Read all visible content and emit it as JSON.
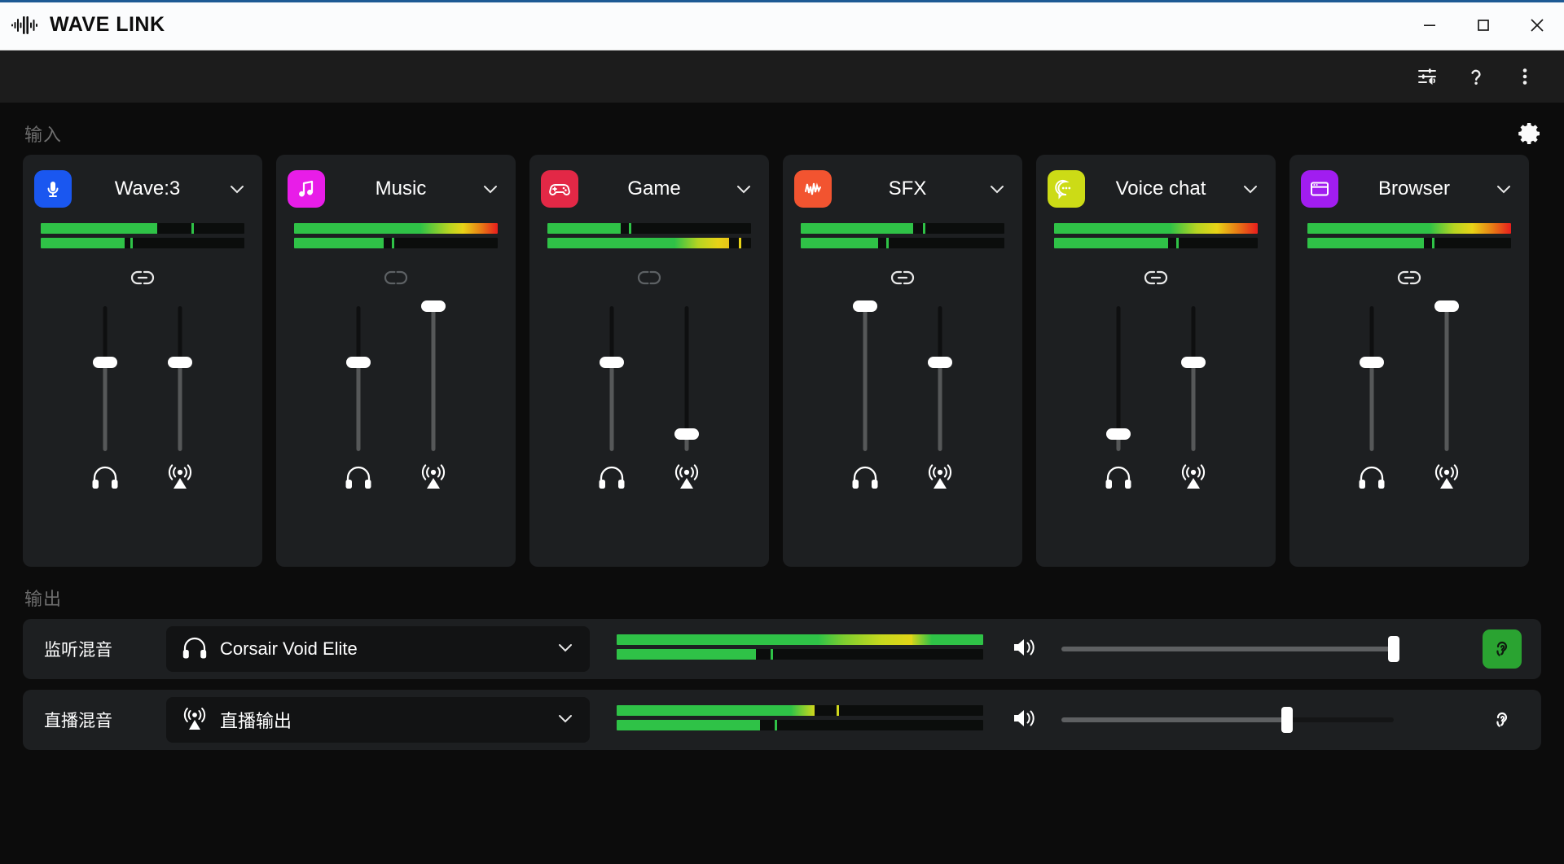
{
  "window": {
    "title": "WAVE LINK",
    "logo_icon": "waveform-icon",
    "minimize_label": "–",
    "maximize_label": "□",
    "close_label": "✕"
  },
  "toolbar": {
    "items": [
      {
        "name": "mixer-settings-icon",
        "label": "Mixer settings"
      },
      {
        "name": "help-icon",
        "label": "?"
      },
      {
        "name": "more-menu-icon",
        "label": "More options"
      }
    ]
  },
  "input_section": {
    "title": "输入",
    "settings_icon": "gear-icon",
    "channels": [
      {
        "id": "wave3",
        "name": "Wave:3",
        "icon": "microphone-icon",
        "icon_color": "#1a57f0",
        "linked": true,
        "link_icon": "link-connected-icon",
        "meters": [
          {
            "level": 57,
            "peak": 74,
            "gradient": false
          },
          {
            "level": 41,
            "peak": 44,
            "gradient": false
          }
        ],
        "faders": [
          {
            "name": "monitor-fader",
            "icon": "headphones-icon",
            "value": 61
          },
          {
            "name": "stream-fader",
            "icon": "broadcast-icon",
            "value": 61
          }
        ]
      },
      {
        "id": "music",
        "name": "Music",
        "icon": "music-note-icon",
        "icon_color": "#e81de8",
        "linked": false,
        "link_icon": "link-broken-icon",
        "meters": [
          {
            "level": 100,
            "peak": 0,
            "gradient": true
          },
          {
            "level": 44,
            "peak": 48,
            "gradient": false
          }
        ],
        "faders": [
          {
            "name": "monitor-fader",
            "icon": "headphones-icon",
            "value": 61
          },
          {
            "name": "stream-fader",
            "icon": "broadcast-icon",
            "value": 100
          }
        ]
      },
      {
        "id": "game",
        "name": "Game",
        "icon": "gamepad-icon",
        "icon_color": "#e32846",
        "linked": false,
        "link_icon": "link-broken-icon",
        "meters": [
          {
            "level": 36,
            "peak": 40,
            "gradient": false
          },
          {
            "level": 89,
            "peak": 94,
            "gradient": true
          }
        ],
        "faders": [
          {
            "name": "monitor-fader",
            "icon": "headphones-icon",
            "value": 61
          },
          {
            "name": "stream-fader",
            "icon": "broadcast-icon",
            "value": 12
          }
        ]
      },
      {
        "id": "sfx",
        "name": "SFX",
        "icon": "sfx-waveform-icon",
        "icon_color": "#f25430",
        "linked": true,
        "link_icon": "link-connected-icon",
        "meters": [
          {
            "level": 55,
            "peak": 60,
            "gradient": false
          },
          {
            "level": 38,
            "peak": 42,
            "gradient": false
          }
        ],
        "faders": [
          {
            "name": "monitor-fader",
            "icon": "headphones-icon",
            "value": 100
          },
          {
            "name": "stream-fader",
            "icon": "broadcast-icon",
            "value": 61
          }
        ]
      },
      {
        "id": "voicechat",
        "name": "Voice chat",
        "icon": "speech-bubble-icon",
        "icon_color": "#ccdb16",
        "linked": true,
        "link_icon": "link-connected-icon",
        "meters": [
          {
            "level": 100,
            "peak": 0,
            "gradient": true
          },
          {
            "level": 56,
            "peak": 60,
            "gradient": false
          }
        ],
        "faders": [
          {
            "name": "monitor-fader",
            "icon": "headphones-icon",
            "value": 12
          },
          {
            "name": "stream-fader",
            "icon": "broadcast-icon",
            "value": 61
          }
        ]
      },
      {
        "id": "browser",
        "name": "Browser",
        "icon": "browser-window-icon",
        "icon_color": "#a11df0",
        "linked": true,
        "link_icon": "link-connected-icon",
        "meters": [
          {
            "level": 100,
            "peak": 0,
            "gradient": true
          },
          {
            "level": 57,
            "peak": 61,
            "gradient": false
          }
        ],
        "faders": [
          {
            "name": "monitor-fader",
            "icon": "headphones-icon",
            "value": 61
          },
          {
            "name": "stream-fader",
            "icon": "broadcast-icon",
            "value": 100
          }
        ]
      }
    ]
  },
  "output_section": {
    "title": "输出",
    "rows": [
      {
        "id": "monitor-mix",
        "label": "监听混音",
        "device_icon": "headphones-icon",
        "device": "Corsair Void Elite",
        "caret_icon": "chevron-down-icon",
        "meters": [
          {
            "level": 100,
            "peak": 0,
            "gradient": true
          },
          {
            "level": 38,
            "peak": 42,
            "gradient": false
          }
        ],
        "volume_icon": "speaker-icon",
        "volume": 100,
        "monitor_icon": "ear-icon",
        "monitor_active": true
      },
      {
        "id": "stream-mix",
        "label": "直播混音",
        "device_icon": "broadcast-icon",
        "device": "直播输出",
        "caret_icon": "chevron-down-icon",
        "meters": [
          {
            "level": 54,
            "peak": 60,
            "gradient": true
          },
          {
            "level": 39,
            "peak": 43,
            "gradient": false
          }
        ],
        "volume_icon": "speaker-icon",
        "volume": 68,
        "monitor_icon": "ear-icon",
        "monitor_active": false
      }
    ]
  },
  "colors": {
    "meter_green": "#2fc247",
    "accent_green": "#2aa331",
    "panel": "#1d1f21",
    "background": "#0c0c0c"
  }
}
